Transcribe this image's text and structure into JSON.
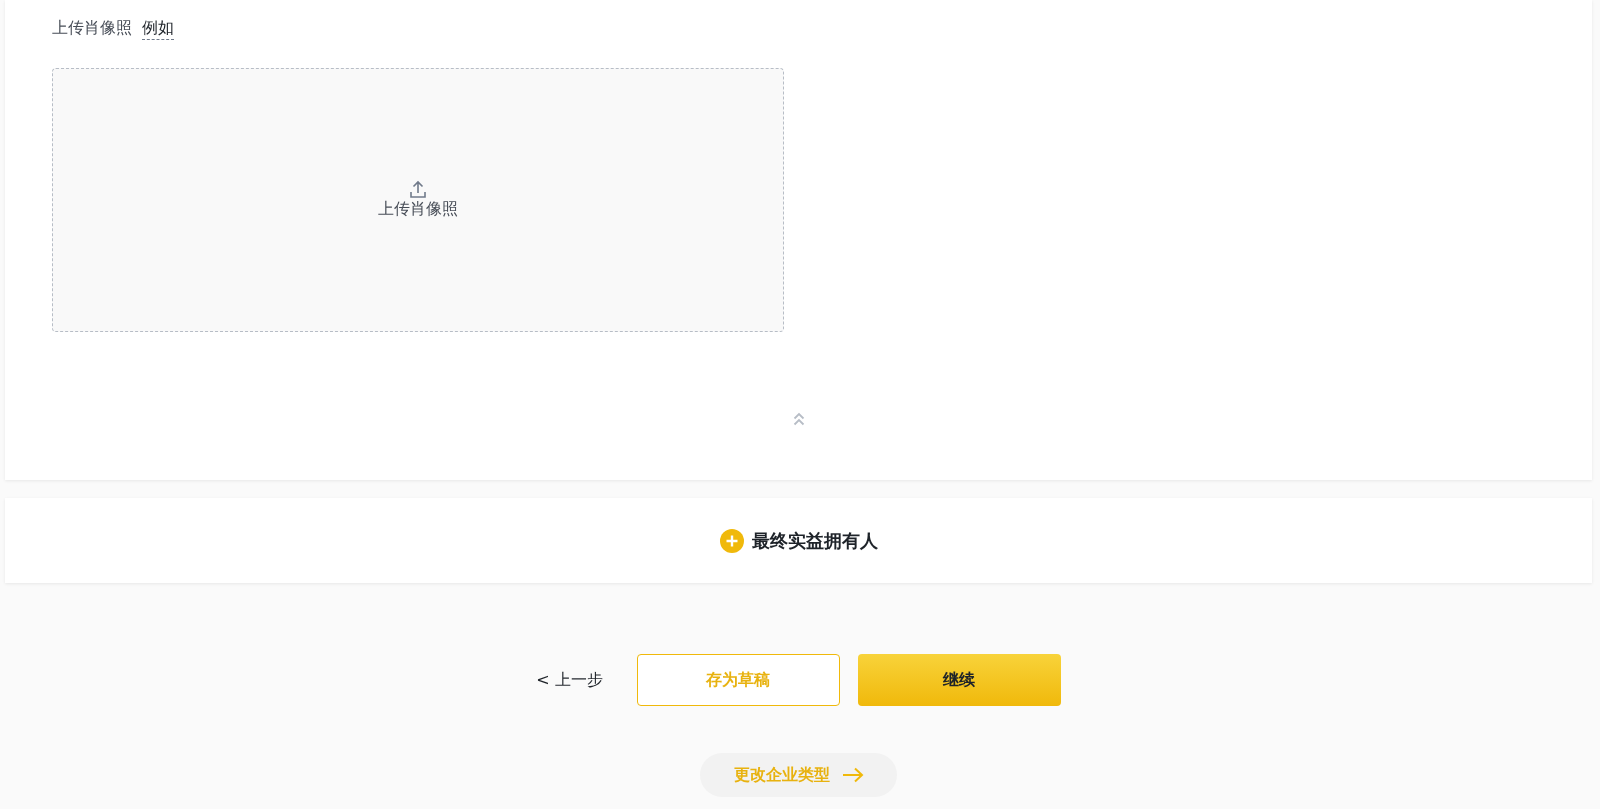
{
  "upload_section": {
    "label": "上传肖像照",
    "example_link": "例如",
    "dropzone": {
      "text": "上传肖像照"
    }
  },
  "beneficial_owner": {
    "text": "最终实益拥有人"
  },
  "actions": [
    {
      "kind": "back",
      "label": "< 上一步"
    },
    {
      "kind": "outline",
      "label": "存为草稿"
    },
    {
      "kind": "primary",
      "label": "继续"
    }
  ],
  "change_type": {
    "label": "更改企业类型"
  }
}
